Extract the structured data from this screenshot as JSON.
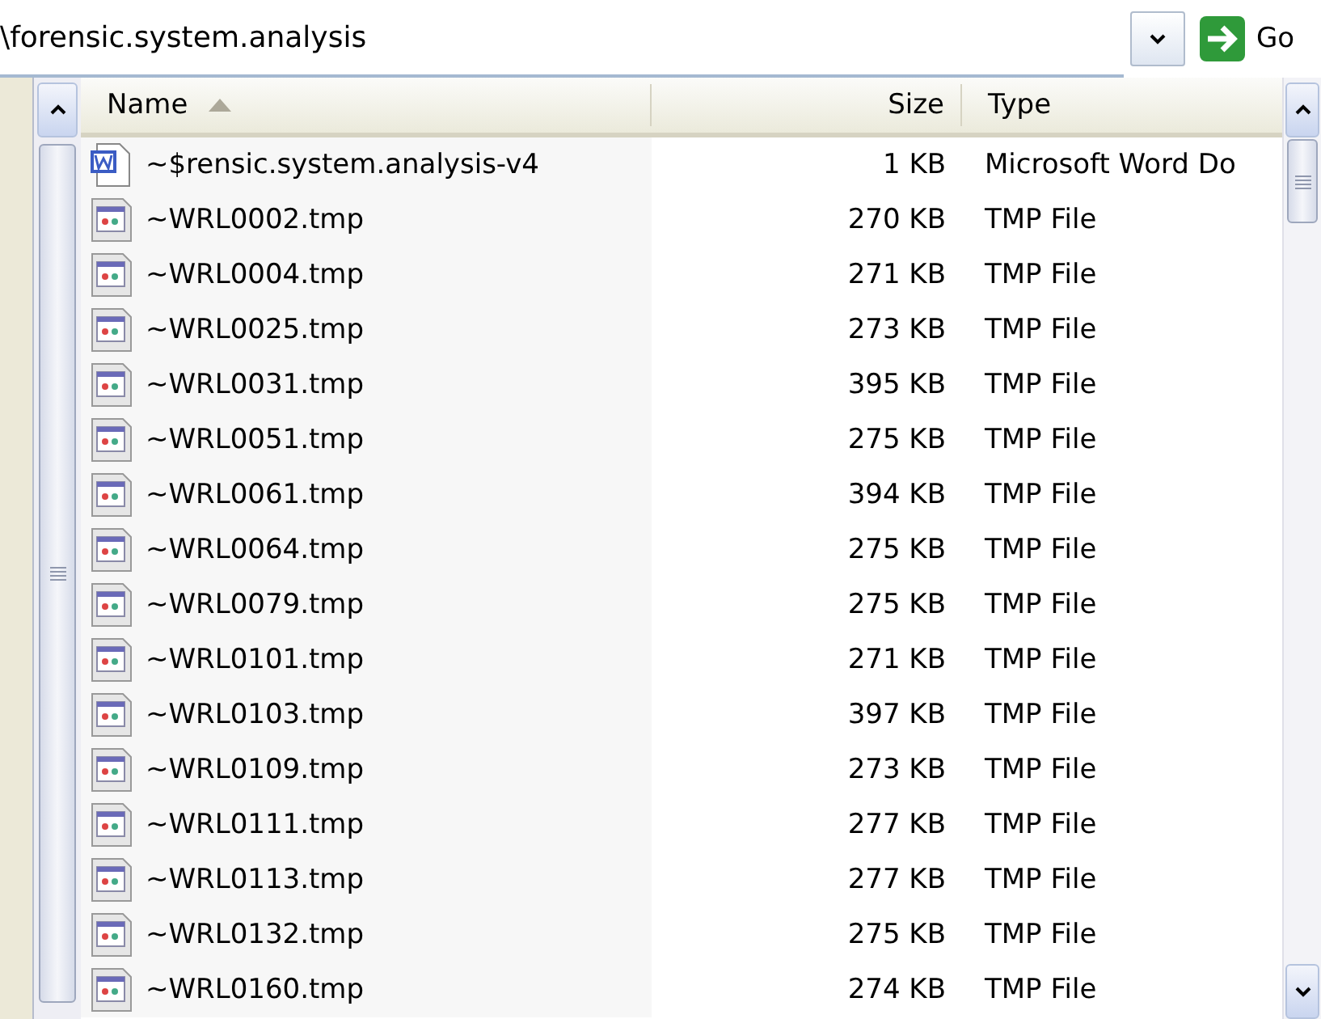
{
  "address_bar": {
    "value": "\\forensic.system.analysis",
    "go_button": "Go"
  },
  "table": {
    "columns": [
      {
        "label": "Name",
        "sorted": true
      },
      {
        "label": "Size",
        "sorted": false
      },
      {
        "label": "Type",
        "sorted": false
      }
    ],
    "rows": [
      {
        "kind": "word",
        "name": "~$rensic.system.analysis-v4",
        "size": "1 KB",
        "type": "Microsoft Word Do"
      },
      {
        "kind": "tmp",
        "name": "~WRL0002.tmp",
        "size": "270 KB",
        "type": "TMP File"
      },
      {
        "kind": "tmp",
        "name": "~WRL0004.tmp",
        "size": "271 KB",
        "type": "TMP File"
      },
      {
        "kind": "tmp",
        "name": "~WRL0025.tmp",
        "size": "273 KB",
        "type": "TMP File"
      },
      {
        "kind": "tmp",
        "name": "~WRL0031.tmp",
        "size": "395 KB",
        "type": "TMP File"
      },
      {
        "kind": "tmp",
        "name": "~WRL0051.tmp",
        "size": "275 KB",
        "type": "TMP File"
      },
      {
        "kind": "tmp",
        "name": "~WRL0061.tmp",
        "size": "394 KB",
        "type": "TMP File"
      },
      {
        "kind": "tmp",
        "name": "~WRL0064.tmp",
        "size": "275 KB",
        "type": "TMP File"
      },
      {
        "kind": "tmp",
        "name": "~WRL0079.tmp",
        "size": "275 KB",
        "type": "TMP File"
      },
      {
        "kind": "tmp",
        "name": "~WRL0101.tmp",
        "size": "271 KB",
        "type": "TMP File"
      },
      {
        "kind": "tmp",
        "name": "~WRL0103.tmp",
        "size": "397 KB",
        "type": "TMP File"
      },
      {
        "kind": "tmp",
        "name": "~WRL0109.tmp",
        "size": "273 KB",
        "type": "TMP File"
      },
      {
        "kind": "tmp",
        "name": "~WRL0111.tmp",
        "size": "277 KB",
        "type": "TMP File"
      },
      {
        "kind": "tmp",
        "name": "~WRL0113.tmp",
        "size": "277 KB",
        "type": "TMP File"
      },
      {
        "kind": "tmp",
        "name": "~WRL0132.tmp",
        "size": "275 KB",
        "type": "TMP File"
      },
      {
        "kind": "tmp",
        "name": "~WRL0160.tmp",
        "size": "274 KB",
        "type": "TMP File"
      }
    ]
  }
}
